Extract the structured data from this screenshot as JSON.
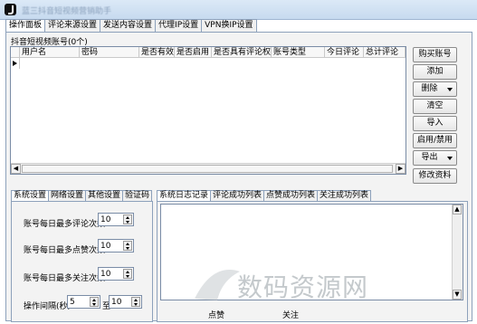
{
  "window": {
    "title": "蓝三抖音短视频营销助手"
  },
  "main_tabs": [
    "操作面板",
    "评论来源设置",
    "发送内容设置",
    "代理IP设置",
    "VPN换IP设置"
  ],
  "account_group": {
    "label": "抖音短视频账号(0个)",
    "columns": [
      "用户名",
      "密码",
      "是否有效",
      "是否启用",
      "是否具有评论权限",
      "账号类型",
      "今日评论",
      "总计评论"
    ]
  },
  "side_buttons": {
    "buy": "购买账号",
    "add": "添加",
    "delete": "删除",
    "clear": "清空",
    "import": "导入",
    "toggle": "启用/禁用",
    "export": "导出",
    "edit": "修改资料"
  },
  "settings_tabs": [
    "系统设置",
    "网络设置",
    "其他设置",
    "验证码"
  ],
  "log_tabs": [
    "系统日志记录",
    "评论成功列表",
    "点赞成功列表",
    "关注成功列表"
  ],
  "settings": {
    "max_comments_label": "账号每日最多评论次数",
    "max_comments_value": "10",
    "max_likes_label": "账号每日最多点赞次数",
    "max_likes_value": "10",
    "max_follows_label": "账号每日最多关注次数",
    "max_follows_value": "10",
    "interval_label": "操作间隔(秒)",
    "interval_from": "5",
    "interval_to_label": "至",
    "interval_to": "10"
  },
  "bottom_partial": {
    "a": "点赞",
    "b": "关注"
  },
  "watermark": "数码资源网"
}
